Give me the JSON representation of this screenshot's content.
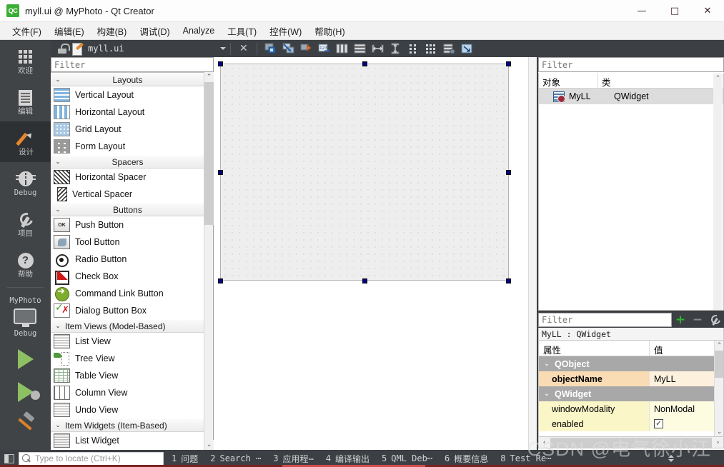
{
  "window": {
    "title": "myll.ui @ MyPhoto - Qt Creator",
    "logo_text": "QC",
    "minimize": "—",
    "maximize": "□",
    "close": "✕"
  },
  "menubar": {
    "items": [
      {
        "label": "文件(F)"
      },
      {
        "label": "编辑(E)"
      },
      {
        "label": "构建(B)"
      },
      {
        "label": "调试(D)"
      },
      {
        "label": "Analyze"
      },
      {
        "label": "工具(T)"
      },
      {
        "label": "控件(W)"
      },
      {
        "label": "帮助(H)"
      }
    ]
  },
  "modebar": {
    "modes": [
      {
        "label": "欢迎",
        "icon": "grid-icon"
      },
      {
        "label": "编辑",
        "icon": "document-icon"
      },
      {
        "label": "设计",
        "icon": "pencil-icon",
        "active": true
      },
      {
        "label": "Debug",
        "icon": "bug-icon"
      },
      {
        "label": "项目",
        "icon": "wrench-icon"
      },
      {
        "label": "帮助",
        "icon": "question-icon"
      }
    ],
    "kit": {
      "project": "MyPhoto",
      "build_config": "Debug",
      "run_label": "run-button",
      "debug_label": "start-debugging-button",
      "build_label": "build-button"
    }
  },
  "editor_toolbar": {
    "file_name": "myll.ui",
    "close_label": "✕",
    "buttons": [
      {
        "name": "edit-widgets-button"
      },
      {
        "name": "edit-signals-slots-button"
      },
      {
        "name": "edit-buddies-button"
      },
      {
        "name": "edit-tab-order-button"
      },
      {
        "name": "layout-horizontally-button"
      },
      {
        "name": "layout-vertically-button"
      },
      {
        "name": "layout-horizontally-in-splitter-button"
      },
      {
        "name": "layout-vertically-in-splitter-button"
      },
      {
        "name": "layout-in-form-layout-button"
      },
      {
        "name": "layout-in-grid-button"
      },
      {
        "name": "break-layout-button"
      },
      {
        "name": "adjust-size-button"
      }
    ]
  },
  "widgetbox": {
    "filter_placeholder": "Filter",
    "groups": [
      {
        "title": "Layouts",
        "centered": true,
        "items": [
          {
            "label": "Vertical Layout",
            "icon": "vertical-layout-icon",
            "cls": "ic-vlayout"
          },
          {
            "label": "Horizontal Layout",
            "icon": "horizontal-layout-icon",
            "cls": "ic-hlayout"
          },
          {
            "label": "Grid Layout",
            "icon": "grid-layout-icon",
            "cls": "ic-grid"
          },
          {
            "label": "Form Layout",
            "icon": "form-layout-icon",
            "cls": "ic-form"
          }
        ]
      },
      {
        "title": "Spacers",
        "centered": true,
        "items": [
          {
            "label": "Horizontal Spacer",
            "icon": "horizontal-spacer-icon",
            "cls": "ic-hspacer"
          },
          {
            "label": "Vertical Spacer",
            "icon": "vertical-spacer-icon",
            "cls": "ic-vspacer"
          }
        ]
      },
      {
        "title": "Buttons",
        "centered": true,
        "items": [
          {
            "label": "Push Button",
            "icon": "push-button-icon",
            "cls": "ic-push",
            "glyph": "OK"
          },
          {
            "label": "Tool Button",
            "icon": "tool-button-icon",
            "cls": "ic-tool"
          },
          {
            "label": "Radio Button",
            "icon": "radio-button-icon",
            "cls": "ic-radio"
          },
          {
            "label": "Check Box",
            "icon": "check-box-icon",
            "cls": "ic-check"
          },
          {
            "label": "Command Link Button",
            "icon": "command-link-button-icon",
            "cls": "ic-cmdlink"
          },
          {
            "label": "Dialog Button Box",
            "icon": "dialog-button-box-icon",
            "cls": "ic-dlgbtn"
          }
        ]
      },
      {
        "title": "Item Views (Model-Based)",
        "centered": false,
        "items": [
          {
            "label": "List View",
            "icon": "list-view-icon",
            "cls": "ic-listview"
          },
          {
            "label": "Tree View",
            "icon": "tree-view-icon",
            "cls": "ic-treeview"
          },
          {
            "label": "Table View",
            "icon": "table-view-icon",
            "cls": "ic-tableview"
          },
          {
            "label": "Column View",
            "icon": "column-view-icon",
            "cls": "ic-colview"
          },
          {
            "label": "Undo View",
            "icon": "undo-view-icon",
            "cls": "ic-undoview"
          }
        ]
      },
      {
        "title": "Item Widgets (Item-Based)",
        "centered": false,
        "items": [
          {
            "label": "List Widget",
            "icon": "list-widget-icon",
            "cls": "ic-listview"
          }
        ]
      }
    ],
    "chevron_expanded": "⌄",
    "scroll_up": "⌃",
    "scroll_down": "⌄"
  },
  "canvas": {
    "form_name": "MyLL",
    "selected": true
  },
  "object_inspector": {
    "filter_placeholder": "Filter",
    "columns": [
      "对象",
      "类"
    ],
    "rows": [
      {
        "object": "MyLL",
        "class": "QWidget"
      }
    ]
  },
  "property_editor": {
    "filter_placeholder": "Filter",
    "add_label": "+",
    "remove_label": "−",
    "configure_label": "wrench",
    "object_line": "MyLL : QWidget",
    "columns": [
      "属性",
      "值"
    ],
    "groups": [
      {
        "name": "QObject",
        "rows": [
          {
            "key": "objectName",
            "value": "MyLL",
            "style": "row-orange",
            "type": "text"
          }
        ]
      },
      {
        "name": "QWidget",
        "rows": [
          {
            "key": "windowModality",
            "value": "NonModal",
            "style": "row-yellow",
            "type": "text"
          },
          {
            "key": "enabled",
            "value": "✓",
            "style": "row-yellow",
            "type": "check"
          }
        ]
      }
    ],
    "chevron": "⌄"
  },
  "statusbar": {
    "locator_placeholder": "Type to locate (Ctrl+K)",
    "panes": [
      {
        "num": "1",
        "label": "问题"
      },
      {
        "num": "2",
        "label": "Search ⋯"
      },
      {
        "num": "3",
        "label": "应用程⋯"
      },
      {
        "num": "4",
        "label": "编译输出"
      },
      {
        "num": "5",
        "label": "QML Deb⋯"
      },
      {
        "num": "6",
        "label": "概要信息"
      },
      {
        "num": "8",
        "label": "Test Re⋯"
      }
    ]
  },
  "watermark": {
    "text": "CSDN @电气徐小江"
  }
}
